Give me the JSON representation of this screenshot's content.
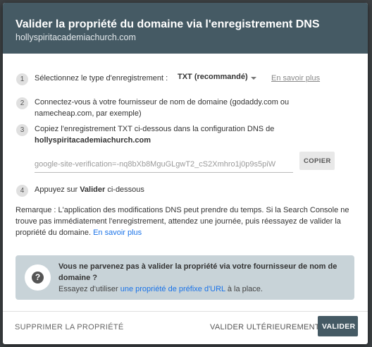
{
  "header": {
    "title": "Valider la propriété du domaine via l'enregistrement DNS",
    "domain": "hollyspiritacademiachurch.com"
  },
  "steps": [
    {
      "num": "1",
      "label": "Sélectionnez le type d'enregistrement :",
      "select_value": "TXT (recommandé)",
      "link": "En savoir plus"
    },
    {
      "num": "2",
      "line1": "Connectez-vous à votre fournisseur de nom de domaine (godaddy.com ou",
      "line2": "namecheap.com, par exemple)"
    },
    {
      "num": "3",
      "line1": "Copiez l'enregistrement TXT ci-dessous dans la configuration DNS de",
      "domain": "hollyspiritacademiachurch.com"
    },
    {
      "num": "4",
      "prefix": "Appuyez sur ",
      "bold": "Valider",
      "suffix": " ci-dessous"
    }
  ],
  "verification": {
    "value": "google-site-verification=-nq8bXb8MguGLgwT2_cS2Xmhro1j0p9s5piW",
    "copy_label": "COPIER"
  },
  "remark": {
    "line1": "Remarque : L'application des modifications DNS peut prendre du temps. Si la Search Console ne",
    "line2": "trouve pas immédiatement l'enregistrement, attendez une journée, puis réessayez de valider la",
    "line3": "propriété du domaine.",
    "link": "En savoir plus"
  },
  "notice": {
    "icon": "question-icon",
    "title_line1": "Vous ne parvenez pas à valider la propriété via votre fournisseur de nom de",
    "title_line2": "domaine ?",
    "text_prefix": "Essayez d'utiliser ",
    "link": "une propriété de préfixe d'URL",
    "text_suffix": " à la place."
  },
  "footer": {
    "delete_label": "SUPPRIMER LA PROPRIÉTÉ",
    "later_label": "VALIDER ULTÉRIEUREMENT",
    "verify_label": "VALIDER"
  },
  "colors": {
    "header_bg": "#455a64",
    "link": "#1a73e8",
    "notice_bg": "#c8d3d8"
  }
}
